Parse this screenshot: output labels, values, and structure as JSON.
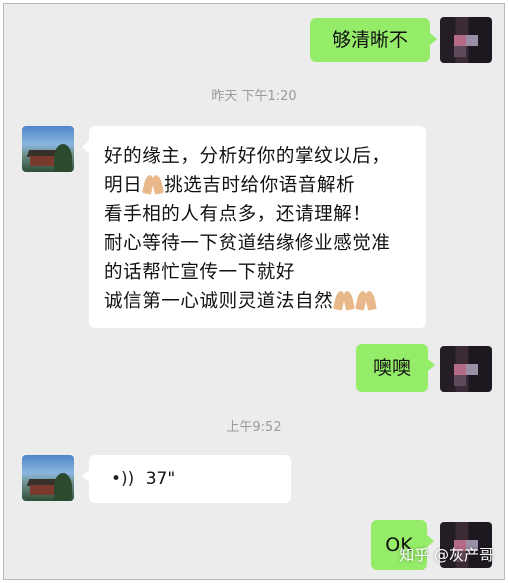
{
  "messages": {
    "sent_1": "够清晰不",
    "timestamp_1": "昨天 下午1:20",
    "received_1_lines": [
      "好的缘主，分析好你的掌纹以后，",
      "明日",
      "挑选吉时给你语音解析",
      "看手相的人有点多，还请理解！",
      "耐心等待一下贫道结缘修业感觉准",
      "的话帮忙宣传一下就好",
      "诚信第一心诚则灵道法自然"
    ],
    "sent_2": "噢噢",
    "timestamp_2": "上午9:52",
    "voice_duration": "37\"",
    "sent_3": "OK"
  },
  "watermark": "知乎 @灰产哥",
  "icons": {
    "voice": "voice-waves-icon",
    "praying": "praying-hands-icon"
  },
  "colors": {
    "sent_bubble": "#95ec69",
    "received_bubble": "#ffffff",
    "background": "#ececec",
    "timestamp_text": "#9a9a9a"
  }
}
